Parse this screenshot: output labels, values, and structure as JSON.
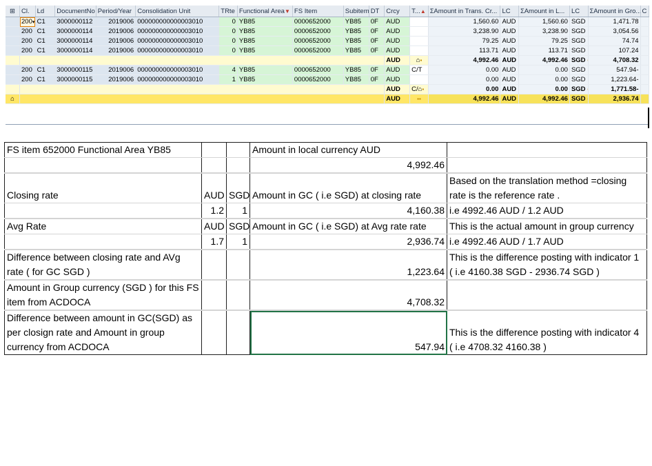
{
  "alv": {
    "headers": [
      "Cl.",
      "Ld",
      "DocumentNo",
      "Period/Year",
      "Consolidation Unit",
      "TRte",
      "Functional Area",
      "FS Item",
      "Subitem",
      "DT",
      "Crcy",
      "T...",
      "Amount in Trans. Cr...",
      "LC",
      "Amount in L...",
      "LC",
      "Amount in Gro...",
      "C"
    ],
    "rows": [
      {
        "type": "data",
        "cells": [
          "200",
          "C1",
          "3000000112",
          "2019006",
          "000000000000003010",
          "0",
          "YB85",
          "0000652000",
          "YB85",
          "0F",
          "AUD",
          "",
          "1,560.60",
          "AUD",
          "1,560.60",
          "SGD",
          "1,471.78"
        ]
      },
      {
        "type": "data",
        "cells": [
          "200",
          "C1",
          "3000000114",
          "2019006",
          "000000000000003010",
          "0",
          "YB85",
          "0000652000",
          "YB85",
          "0F",
          "AUD",
          "",
          "3,238.90",
          "AUD",
          "3,238.90",
          "SGD",
          "3,054.56"
        ]
      },
      {
        "type": "data",
        "cells": [
          "200",
          "C1",
          "3000000114",
          "2019006",
          "000000000000003010",
          "0",
          "YB85",
          "0000652000",
          "YB85",
          "0F",
          "AUD",
          "",
          "79.25",
          "AUD",
          "79.25",
          "SGD",
          "74.74"
        ]
      },
      {
        "type": "data",
        "cells": [
          "200",
          "C1",
          "3000000114",
          "2019006",
          "000000000000003010",
          "0",
          "YB85",
          "0000652000",
          "YB85",
          "0F",
          "AUD",
          "",
          "113.71",
          "AUD",
          "113.71",
          "SGD",
          "107.24"
        ]
      },
      {
        "type": "sub",
        "cells": [
          "",
          "",
          "",
          "",
          "",
          "",
          "",
          "",
          "",
          "",
          "AUD",
          "",
          "4,992.46",
          "AUD",
          "4,992.46",
          "SGD",
          "4,708.32"
        ]
      },
      {
        "type": "data",
        "cells": [
          "200",
          "C1",
          "3000000115",
          "2019006",
          "000000000000003010",
          "4",
          "YB85",
          "0000652000",
          "YB85",
          "0F",
          "AUD",
          "C/T",
          "0.00",
          "AUD",
          "0.00",
          "SGD",
          "547.94-"
        ]
      },
      {
        "type": "data",
        "cells": [
          "200",
          "C1",
          "3000000115",
          "2019006",
          "000000000000003010",
          "1",
          "YB85",
          "0000652000",
          "YB85",
          "0F",
          "AUD",
          "",
          "0.00",
          "AUD",
          "0.00",
          "SGD",
          "1,223.64-"
        ]
      },
      {
        "type": "sub",
        "cells": [
          "",
          "",
          "",
          "",
          "",
          "",
          "",
          "",
          "",
          "",
          "AUD",
          "C/",
          "0.00",
          "AUD",
          "0.00",
          "SGD",
          "1,771.58-"
        ]
      },
      {
        "type": "tot",
        "cells": [
          "",
          "",
          "",
          "",
          "",
          "",
          "",
          "",
          "",
          "",
          "AUD",
          "",
          "4,992.46",
          "AUD",
          "4,992.46",
          "SGD",
          "2,936.74"
        ]
      }
    ]
  },
  "excel": {
    "rows": [
      {
        "a": "FS item 652000 Functional Area YB85",
        "b": "",
        "c": "",
        "d": "Amount in local currency AUD",
        "e": ""
      },
      {
        "a": "",
        "b": "",
        "c": "",
        "d": "4,992.46",
        "e": ""
      },
      {
        "a": "",
        "b": "",
        "c": "",
        "d": "",
        "e": ""
      },
      {
        "a": "Closing rate",
        "b": "AUD",
        "c": "SGD",
        "d": "Amount in GC ( i.e SGD) at closing rate",
        "e": "Based on the translation method =closing rate is the reference rate ."
      },
      {
        "a": "",
        "b": "1.2",
        "c": "1",
        "d": "4,160.38",
        "e": "i.e 4992.46 AUD / 1.2 AUD"
      },
      {
        "a": "",
        "b": "",
        "c": "",
        "d": "",
        "e": ""
      },
      {
        "a": "Avg Rate",
        "b": "AUD",
        "c": "SGD",
        "d": "Amount in GC ( i.e SGD) at Avg rate rate",
        "e": "This is the actual amount in group currency"
      },
      {
        "a": "",
        "b": "1.7",
        "c": "1",
        "d": "2,936.74",
        "e": "i.e 4992.46 AUD / 1.7 AUD"
      },
      {
        "a": "",
        "b": "",
        "c": "",
        "d": "",
        "e": ""
      },
      {
        "a": "Difference between closing rate and AVg rate ( for GC SGD )",
        "b": "",
        "c": "",
        "d": "1,223.64",
        "e": "This is the difference posting with indicator 1 ( i.e 4160.38 SGD - 2936.74 SGD )"
      },
      {
        "a": "",
        "b": "",
        "c": "",
        "d": "",
        "e": ""
      },
      {
        "a": "Amount in Group currency (SGD ) for this FS item from ACDOCA",
        "b": "",
        "c": "",
        "d": "4,708.32",
        "e": ""
      },
      {
        "a": "",
        "b": "",
        "c": "",
        "d": "",
        "e": ""
      },
      {
        "a": "Difference between amount in GC(SGD) as per closign rate and Amount in group currency from ACDOCA",
        "b": "",
        "c": "",
        "d": "547.94",
        "e": "This is the difference posting with indicator 4 ( i.e 4708.32  4160.38 )"
      }
    ]
  }
}
